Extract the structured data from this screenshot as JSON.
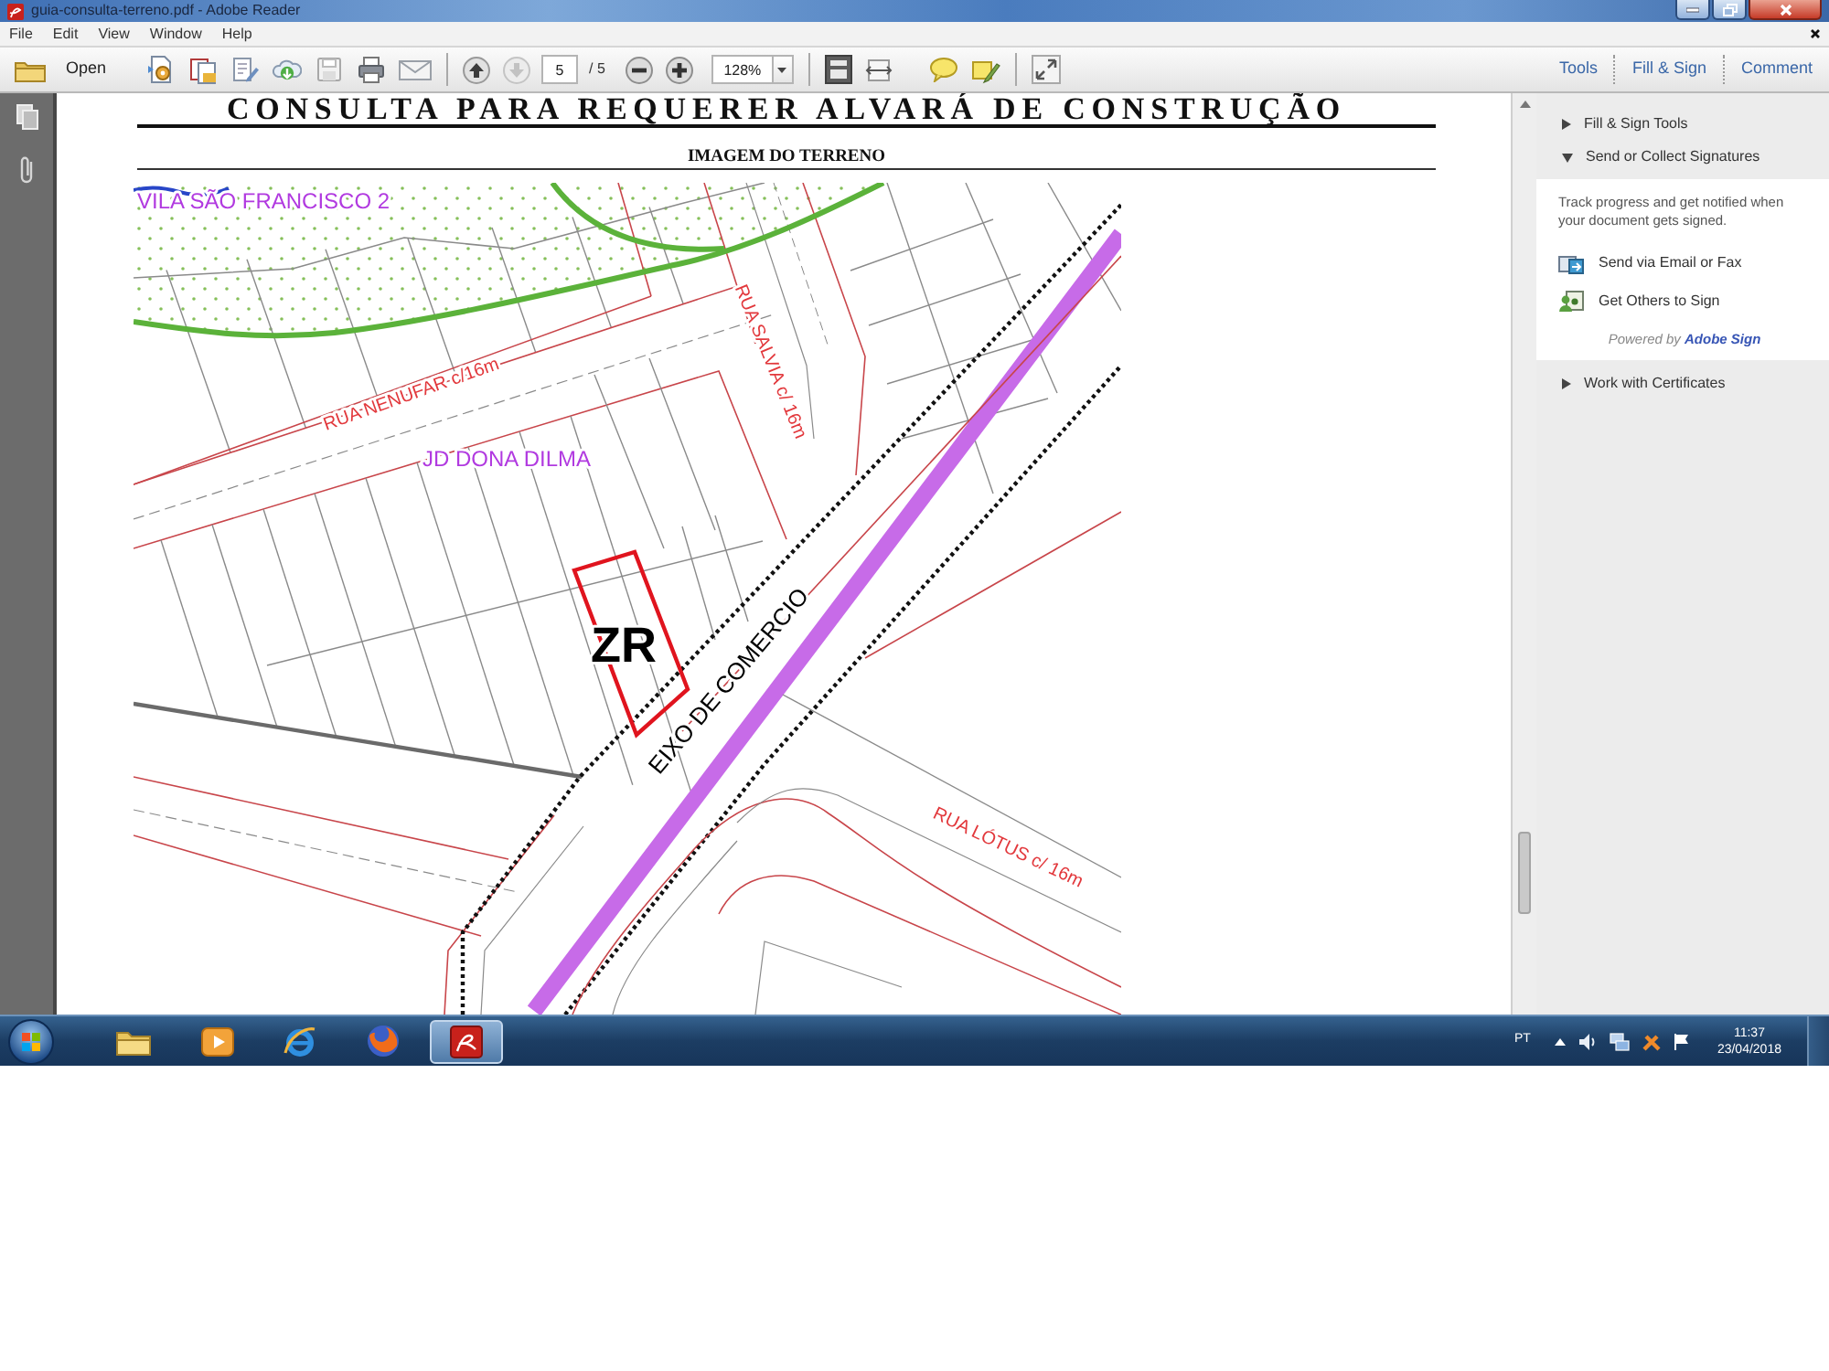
{
  "window": {
    "title": "guia-consulta-terreno.pdf - Adobe Reader"
  },
  "menu": [
    {
      "label": "File"
    },
    {
      "label": "Edit"
    },
    {
      "label": "View"
    },
    {
      "label": "Window"
    },
    {
      "label": "Help"
    }
  ],
  "toolbar": {
    "open_label": "Open",
    "page_number": "5",
    "page_count": "/ 5",
    "zoom": "128%",
    "panes": [
      {
        "label": "Tools",
        "selected": false
      },
      {
        "label": "Fill & Sign",
        "selected": false
      },
      {
        "label": "Comment",
        "selected": false
      }
    ]
  },
  "document": {
    "heading": "CONSULTA PARA REQUERER ALVARÁ DE CONSTRUÇÃO",
    "section_title": "IMAGEM DO TERRENO",
    "map": {
      "labels": [
        {
          "kind": "area",
          "text": "VILA SÃO FRANCISCO 2"
        },
        {
          "kind": "street",
          "text": "RUA NENUFAR c/16m"
        },
        {
          "kind": "street",
          "text": "RUA SALVIA c/ 16m"
        },
        {
          "kind": "area",
          "text": "JD DONA DILMA"
        },
        {
          "kind": "zone",
          "text": "ZR"
        },
        {
          "kind": "axis",
          "text": "EIXO DE COMERCIO"
        },
        {
          "kind": "street",
          "text": "RUA LÓTUS c/ 16m"
        }
      ]
    }
  },
  "side_panel": {
    "sections": [
      {
        "title": "Fill & Sign Tools",
        "expanded": false
      },
      {
        "title": "Send or Collect Signatures",
        "expanded": true,
        "description": "Track progress and get notified when your document gets signed.",
        "actions": [
          {
            "kind": "email",
            "label": "Send via Email or Fax"
          },
          {
            "kind": "others",
            "label": "Get Others to Sign"
          }
        ],
        "powered_by": {
          "text": "Powered by",
          "link": "Adobe Sign"
        }
      },
      {
        "title": "Work with Certificates",
        "expanded": false
      }
    ]
  },
  "taskbar": {
    "apps": [
      {
        "kind": "folder",
        "selected": false
      },
      {
        "kind": "media",
        "selected": false
      },
      {
        "kind": "ie",
        "selected": false
      },
      {
        "kind": "firefox",
        "selected": false
      },
      {
        "kind": "pdf",
        "selected": true
      }
    ],
    "language": "PT",
    "time": "11:37",
    "date": "23/04/2018"
  }
}
